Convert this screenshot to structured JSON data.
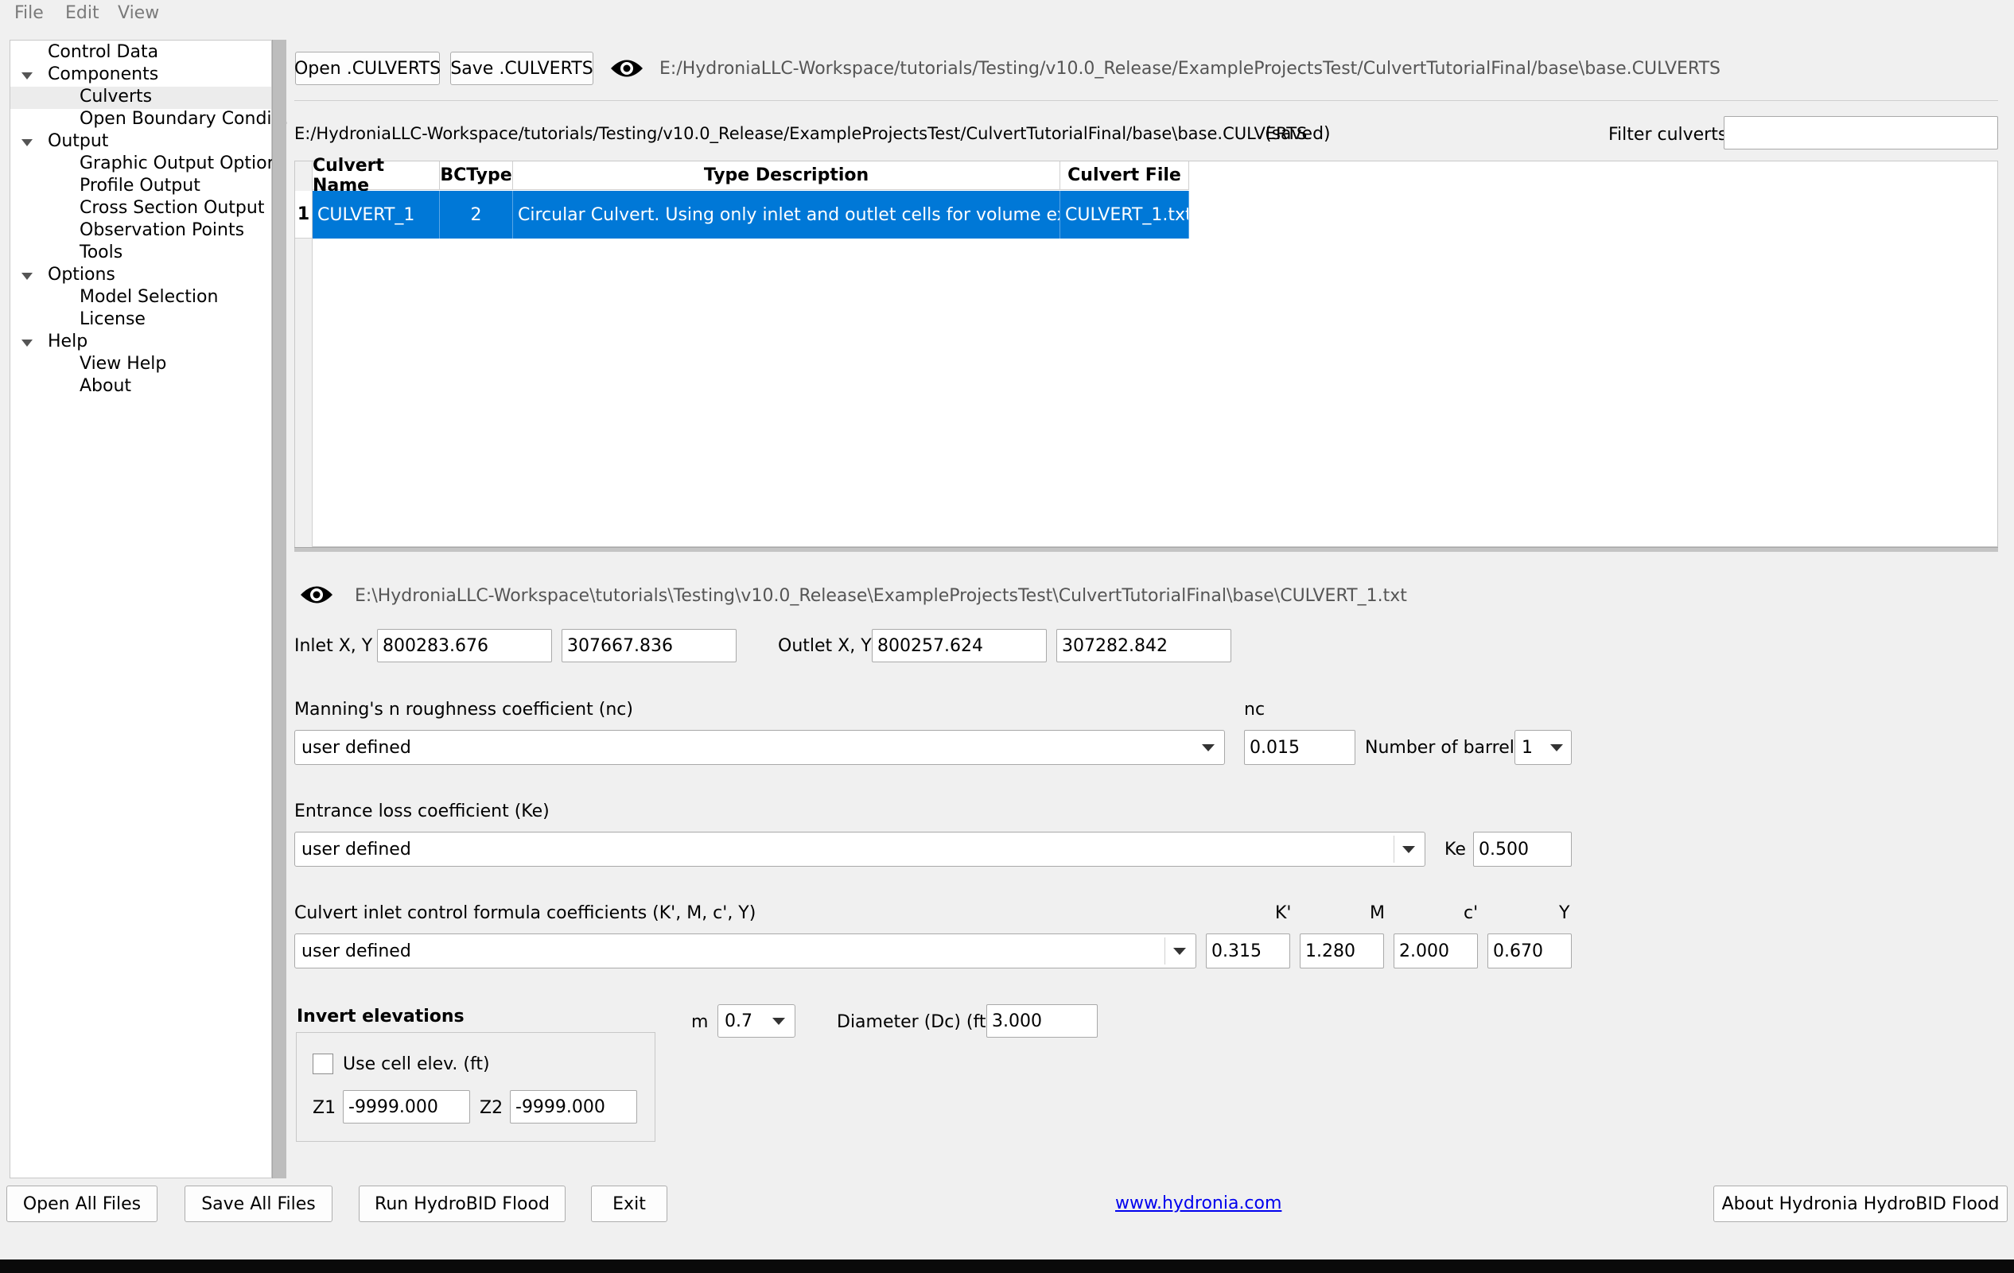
{
  "menu": {
    "file": "File",
    "edit": "Edit",
    "view": "View"
  },
  "tree": {
    "control_data": "Control Data",
    "components": "Components",
    "culverts": "Culverts",
    "open_boundary": "Open Boundary Condi...",
    "output": "Output",
    "graphic_output": "Graphic Output Options",
    "profile_output": "Profile Output",
    "cross_section_output": "Cross Section Output",
    "observation_points": "Observation Points",
    "tools": "Tools",
    "options": "Options",
    "model_selection": "Model Selection",
    "license": "License",
    "help": "Help",
    "view_help": "View Help",
    "about": "About"
  },
  "toolbar": {
    "open_label": "Open .CULVERTS",
    "save_label": "Save .CULVERTS",
    "file_path": "E:/HydroniaLLC-Workspace/tutorials/Testing/v10.0_Release/ExampleProjectsTest/CulvertTutorialFinal/base\\base.CULVERTS"
  },
  "status": {
    "path": "E:/HydroniaLLC-Workspace/tutorials/Testing/v10.0_Release/ExampleProjectsTest/CulvertTutorialFinal/base\\base.CULVERTS",
    "saved": "(saved)",
    "filter_label": "Filter culverts",
    "filter_value": ""
  },
  "table": {
    "headers": {
      "name": "Culvert Name",
      "bctype": "BCType",
      "desc": "Type Description",
      "file": "Culvert File"
    },
    "rows": [
      {
        "num": "1",
        "name": "CULVERT_1",
        "bctype": "2",
        "desc": "Circular Culvert. Using only inlet and outlet cells for volume exchange",
        "file": "CULVERT_1.txt"
      }
    ]
  },
  "detail": {
    "file_path": "E:\\HydroniaLLC-Workspace\\tutorials\\Testing\\v10.0_Release\\ExampleProjectsTest\\CulvertTutorialFinal\\base\\CULVERT_1.txt",
    "inlet_label": "Inlet X, Y",
    "inlet_x": "800283.676",
    "inlet_y": "307667.836",
    "outlet_label": "Outlet X, Y",
    "outlet_x": "800257.624",
    "outlet_y": "307282.842",
    "manning_label": "Manning's n roughness coefficient (nc)",
    "manning_select": "user defined",
    "nc_label": "nc",
    "nc_value": "0.015",
    "barrels_label": "Number of barrels",
    "barrels_value": "1",
    "entrance_label": "Entrance loss coefficient (Ke)",
    "entrance_select": "user defined",
    "ke_label": "Ke",
    "ke_value": "0.500",
    "inlet_control_label": "Culvert inlet control formula coefficients (K', M, c', Y)",
    "inlet_control_select": "user defined",
    "k_label": "K'",
    "k_value": "0.315",
    "m_coef_label": "M",
    "m_coef_value": "1.280",
    "c_label": "c'",
    "c_value": "2.000",
    "y_label": "Y",
    "y_value": "0.670",
    "invert_title": "Invert elevations",
    "use_cell_label": "Use cell elev. (ft)",
    "z1_label": "Z1",
    "z1_value": "-9999.000",
    "z2_label": "Z2",
    "z2_value": "-9999.000",
    "m_label": "m",
    "m_value": "0.7",
    "diameter_label": "Diameter (Dc) (ft)",
    "diameter_value": "3.000"
  },
  "footer": {
    "open_all": "Open All Files",
    "save_all": "Save All Files",
    "run": "Run HydroBID Flood",
    "exit": "Exit",
    "link": "www.hydronia.com",
    "about": "About Hydronia HydroBID Flood"
  }
}
